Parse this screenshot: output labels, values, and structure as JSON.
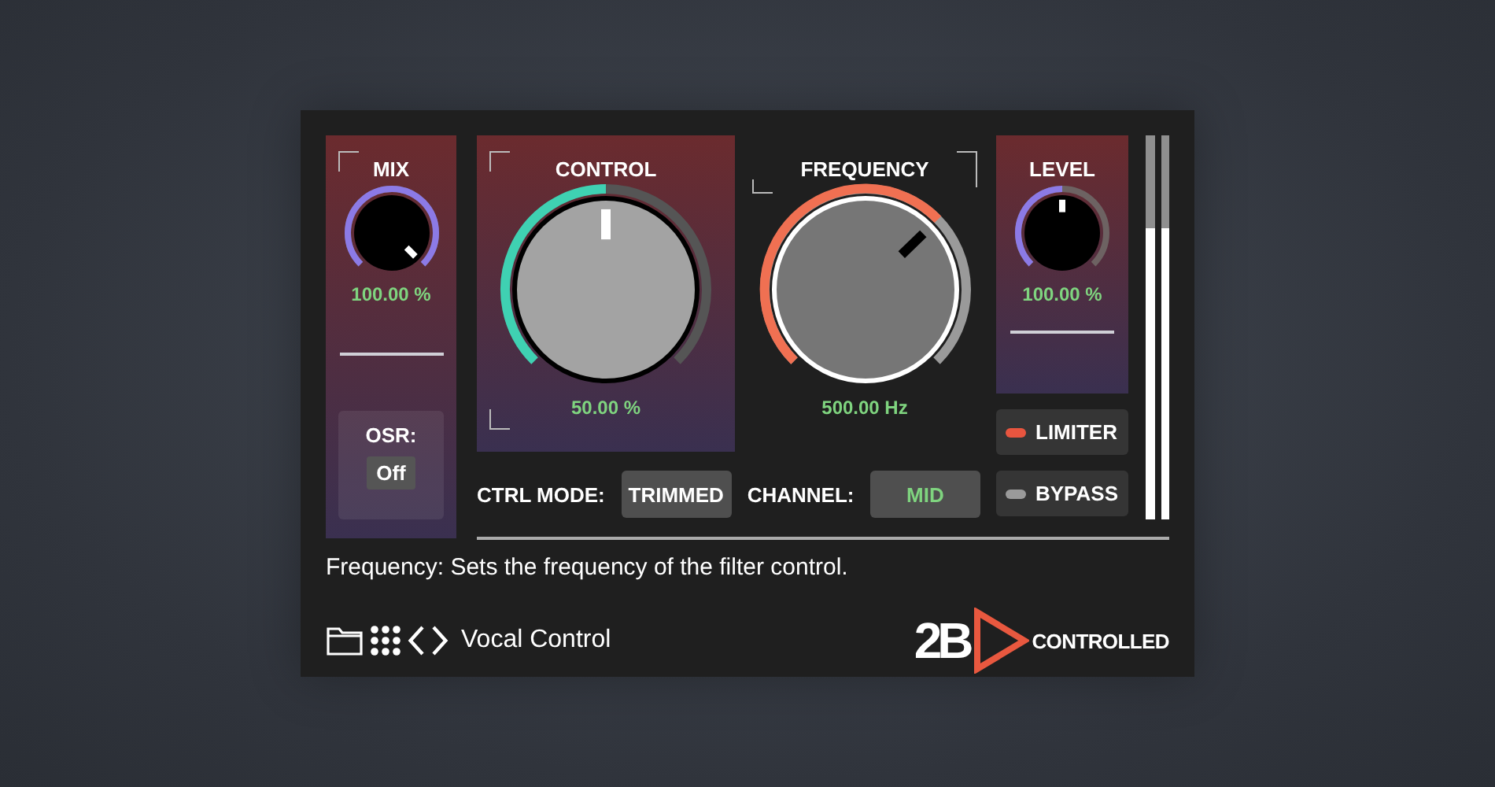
{
  "knobs": [
    {
      "label": "MIX",
      "value": "100.00 %",
      "color": "#8c7ae6",
      "kind": "small"
    },
    {
      "label": "CONTROL",
      "value": "50.00 %",
      "color": "#3fd1b2",
      "kind": "light"
    },
    {
      "label": "FREQUENCY",
      "value": "500.00 Hz",
      "color": "#f07052",
      "kind": "dark"
    },
    {
      "label": "LEVEL",
      "value": "100.00 %",
      "color": "#8c7ae6",
      "kind": "small"
    }
  ],
  "osr": {
    "label": "OSR:",
    "value": "Off"
  },
  "selectors": [
    {
      "label": "CTRL MODE:",
      "value": "TRIMMED"
    },
    {
      "label": "CHANNEL:",
      "value": "MID"
    }
  ],
  "toggles": [
    {
      "label": "LIMITER",
      "on": true
    },
    {
      "label": "BYPASS",
      "on": false
    }
  ],
  "meters": [
    {
      "level": 0.76
    },
    {
      "level": 0.76
    }
  ],
  "help": "Frequency: Sets the frequency of the filter control.",
  "preset": "Vocal Control",
  "logo": {
    "mark": "2B",
    "name": "CONTROLLED"
  }
}
